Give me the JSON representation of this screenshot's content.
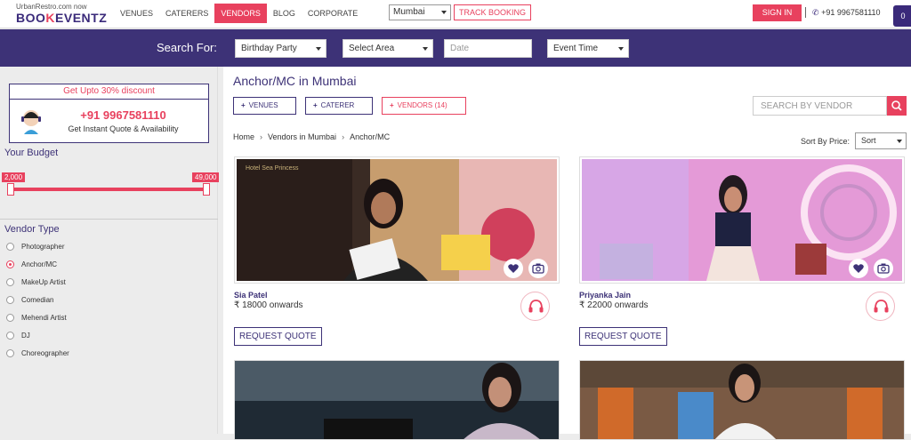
{
  "header": {
    "tagline": "UrbanRestro.com now",
    "brand_a": "BOO",
    "brand_b": "K",
    "brand_c": "EVENTZ",
    "nav": [
      {
        "label": "VENUES"
      },
      {
        "label": "CATERERS"
      },
      {
        "label": "VENDORS",
        "active": true
      },
      {
        "label": "BLOG"
      },
      {
        "label": "CORPORATE"
      }
    ],
    "city": "Mumbai",
    "track": "TRACK BOOKING",
    "signin": "SIGN IN",
    "phone": "+91 9967581110",
    "cart_count": "0"
  },
  "search": {
    "label": "Search For:",
    "occasion": "Birthday Party",
    "area": "Select Area",
    "date_placeholder": "Date",
    "time": "Event Time"
  },
  "sidebar": {
    "promo_head": "Get Upto 30% discount",
    "promo_phone": "+91 9967581110",
    "promo_sub": "Get Instant Quote & Availability",
    "budget_title": "Your Budget",
    "budget_min": "2,000",
    "budget_max": "49,000",
    "budget_low_fraction": 0.0,
    "budget_high_fraction": 1.0,
    "vendor_type_title": "Vendor Type",
    "vendor_types": [
      {
        "label": "Photographer",
        "checked": false
      },
      {
        "label": "Anchor/MC",
        "checked": true
      },
      {
        "label": "MakeUp Artist",
        "checked": false
      },
      {
        "label": "Comedian",
        "checked": false
      },
      {
        "label": "Mehendi Artist",
        "checked": false
      },
      {
        "label": "DJ",
        "checked": false
      },
      {
        "label": "Choreographer",
        "checked": false
      }
    ]
  },
  "main": {
    "title": "Anchor/MC in Mumbai",
    "tabs": [
      {
        "label": "VENUES"
      },
      {
        "label": "CATERER"
      },
      {
        "label": "VENDORS (14)"
      }
    ],
    "vendor_search_placeholder": "SEARCH BY VENDOR",
    "breadcrumb": [
      "Home",
      "Vendors in Mumbai",
      "Anchor/MC"
    ],
    "sort_label": "Sort By Price:",
    "sort_value": "Sort",
    "request_label": "REQUEST QUOTE",
    "vendors": [
      {
        "name": "Sia Patel",
        "price": "₹ 18000 onwards"
      },
      {
        "name": "Priyanka Jain",
        "price": "₹ 22000 onwards"
      }
    ]
  },
  "colors": {
    "accent": "#e8415e",
    "primary": "#3d3277"
  }
}
